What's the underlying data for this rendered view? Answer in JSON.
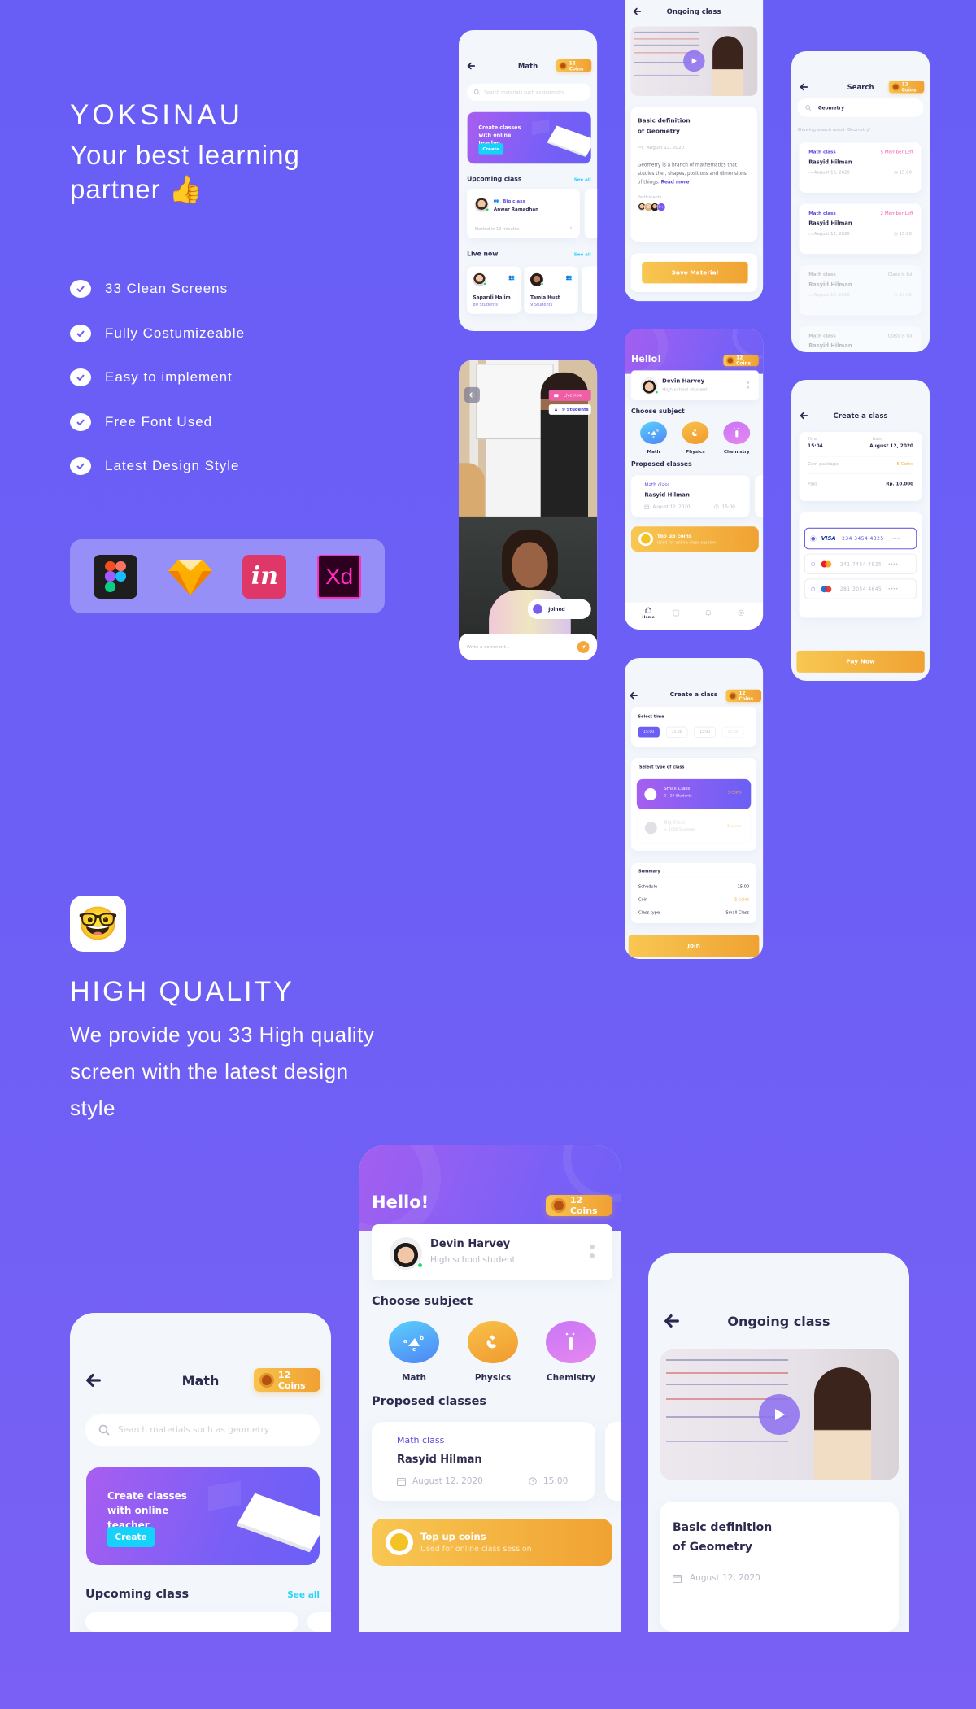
{
  "brand": {
    "title": "YOKSINAU",
    "tagline": "Your best learning partner",
    "tagline_emoji": "👍"
  },
  "features": [
    "33 Clean Screens",
    "Fully Costumizeable",
    "Easy to implement",
    "Free Font Used",
    "Latest Design Style"
  ],
  "tools": [
    {
      "icon": "figma-icon"
    },
    {
      "icon": "sketch-icon"
    },
    {
      "icon": "invision-icon",
      "logo_text": "in",
      "color": "#de3768"
    },
    {
      "icon": "adobe-xd-icon",
      "logo_text": "Xd",
      "color": "#ff2bc2"
    }
  ],
  "quality": {
    "emoji": "🤓",
    "title": "HIGH QUALITY",
    "text": "We provide you 33 High quality screen with the latest design style"
  },
  "colors": {
    "background": "#6a5ef5",
    "accent": "#5a4ddc",
    "coin": "#f4b13f",
    "cyan": "#15d4f9",
    "pink": "#ef5fa8"
  },
  "common": {
    "coins": "12 Coins"
  },
  "math_screen": {
    "title": "Math",
    "search_placeholder": "Search materials such as geometry",
    "banner_text": "Create classes with online teacher",
    "banner_button": "Create",
    "upcoming_title": "Upcoming class",
    "see_all": "See all",
    "upcoming": {
      "badge": "Big class",
      "teacher": "Anwar Ramadhan",
      "status": "Started in 10 minutes"
    },
    "live_title": "Live now",
    "live": [
      {
        "name": "Sapardi Halim",
        "students": "80 Students"
      },
      {
        "name": "Tamia Hust",
        "students": "9 Students"
      }
    ]
  },
  "ongoing": {
    "title": "Ongoing class",
    "heading_line1": "Basic definition",
    "heading_line2": "of Geometry",
    "date": "August 12, 2020",
    "body": "Geometry is a branch of mathematics that studies the , shapes, positions  and dimensions of things.",
    "read_more": "Read more",
    "participants_label": "Participants",
    "participants_more": "9+",
    "save": "Save Material"
  },
  "search": {
    "title": "Search",
    "query": "Geometry",
    "result_text": "Showing search result 'Geometry'",
    "results": [
      {
        "category": "Math class",
        "teacher": "Rasyid Hilman",
        "date": "August 12, 2020",
        "time": "15:00",
        "status": "5 Member Left",
        "available": true
      },
      {
        "category": "Math class",
        "teacher": "Rasyid Hilman",
        "date": "August 12, 2020",
        "time": "15:00",
        "status": "2 Member Left",
        "available": true
      },
      {
        "category": "Math class",
        "teacher": "Rasyid Hilman",
        "date": "August 12, 2020",
        "time": "15:00",
        "status": "Class is full",
        "available": false
      },
      {
        "category": "Math class",
        "teacher": "Rasyid Hilman",
        "date": "August 12, 2020",
        "time": "15:00",
        "status": "Class is full",
        "available": false
      }
    ]
  },
  "live": {
    "badge": "Live now",
    "students": "9 Students",
    "joined": "Joined",
    "comment_placeholder": "Write a comment. . ."
  },
  "home": {
    "greeting": "Hello!",
    "user": {
      "name": "Devin Harvey",
      "role": "High school student"
    },
    "choose_subject": "Choose subject",
    "subjects": [
      {
        "name": "Math",
        "icon": "triangle-abc-icon",
        "color": "#4f9cf7"
      },
      {
        "name": "Physics",
        "icon": "magnet-icon",
        "color": "#f2a938"
      },
      {
        "name": "Chemistry",
        "icon": "test-tube-icon",
        "color": "#d57cf2"
      }
    ],
    "proposed_title": "Proposed classes",
    "proposed": {
      "category": "Math class",
      "teacher": "Rasyid Hilman",
      "date": "August 12, 2020",
      "time": "15:00"
    },
    "topup": {
      "title": "Top up coins",
      "subtitle": "Used for online class session"
    },
    "nav": [
      {
        "label": "Home",
        "icon": "home-icon",
        "active": true
      },
      {
        "icon": "clipboard-icon"
      },
      {
        "icon": "bell-icon"
      },
      {
        "icon": "settings-icon"
      }
    ]
  },
  "payment": {
    "title": "Create a class",
    "time_label": "Time",
    "time": "15:04",
    "date_label": "Date",
    "date": "August 12, 2020",
    "coin_label": "Coin package",
    "coin": "5 Coins",
    "paid_label": "Paid",
    "paid": "Rp. 10.000",
    "cards": [
      {
        "brand": "VISA",
        "number": "234 3454 4325",
        "mask": "••••",
        "selected": true
      },
      {
        "brand": "mastercard-icon",
        "number": "241 7454 4925",
        "mask": "••••",
        "selected": false
      },
      {
        "brand": "maestro-icon",
        "number": "281 3054 4645",
        "mask": "••••",
        "selected": false
      }
    ],
    "pay": "Pay Now"
  },
  "create": {
    "title": "Create a class",
    "select_time": "Select time",
    "times": [
      "15:00",
      "15:00",
      "15:00",
      "15:00"
    ],
    "selected_time_index": 0,
    "select_type": "Select type of class",
    "types": [
      {
        "name": "Small Class",
        "desc": "2 - 20 Students",
        "price": "5 coins",
        "selected": true
      },
      {
        "name": "Big Class",
        "desc": "+ 1000 Students",
        "price": "5 coins",
        "selected": false
      }
    ],
    "summary": {
      "title": "Summary",
      "rows": [
        {
          "label": "Schedule",
          "value": "15:00"
        },
        {
          "label": "Coin",
          "value": "5 coins"
        },
        {
          "label": "Class type",
          "value": "Small Class"
        }
      ]
    },
    "join": "Join"
  }
}
